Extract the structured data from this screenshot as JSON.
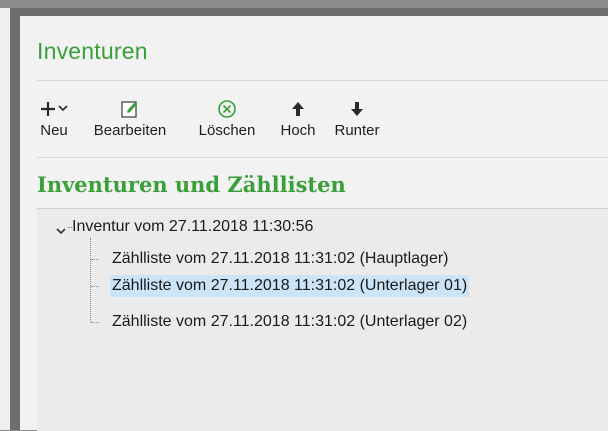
{
  "page": {
    "title": "Inventuren",
    "section_title": "Inventuren und Zähllisten"
  },
  "toolbar": {
    "new": {
      "label": "Neu",
      "icon": "plus-dropdown-icon"
    },
    "edit": {
      "label": "Bearbeiten",
      "icon": "edit-icon"
    },
    "delete": {
      "label": "Löschen",
      "icon": "delete-circle-x-icon"
    },
    "up": {
      "label": "Hoch",
      "icon": "arrow-up-icon"
    },
    "down": {
      "label": "Runter",
      "icon": "arrow-down-icon"
    }
  },
  "tree": {
    "root": {
      "label": "Inventur vom 27.11.2018 11:30:56",
      "expanded": true
    },
    "children": [
      {
        "label": "Zählliste vom 27.11.2018 11:31:02 (Hauptlager)",
        "selected": false
      },
      {
        "label": "Zählliste vom 27.11.2018 11:31:02 (Unterlager 01)",
        "selected": true
      },
      {
        "label": "Zählliste vom 27.11.2018 11:31:02 (Unterlager 02)",
        "selected": false
      }
    ]
  },
  "colors": {
    "accent": "#3a9f3a",
    "selection": "#cce4f7",
    "icon_dark": "#2a2a2a"
  }
}
